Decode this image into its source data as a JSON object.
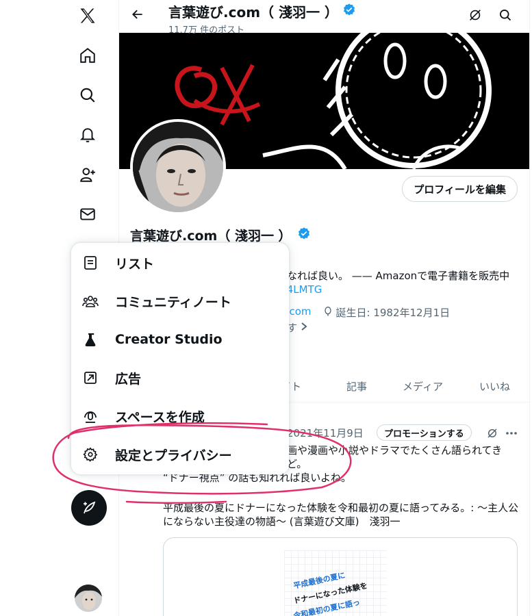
{
  "nav": {
    "items": [
      {
        "name": "x-logo-icon"
      },
      {
        "name": "home-icon"
      },
      {
        "name": "search-icon"
      },
      {
        "name": "notifications-icon"
      },
      {
        "name": "follow-icon"
      },
      {
        "name": "messages-icon"
      }
    ]
  },
  "header": {
    "title": "言葉遊び.com（ 淺羽一 ）",
    "post_count": "11.7万 件のポスト"
  },
  "profile": {
    "name": "言葉遊び.com（ 淺羽一 ）",
    "edit_label": "プロフィールを編集",
    "bio_line": "になれば良い。 —— Amazonで電子書籍を販売中",
    "bio_link": "IB4LMTG",
    "website": "bi.com",
    "birthday": "誕生日: 1982年12月1日",
    "more": "ます"
  },
  "tabs": [
    "イト",
    "記事",
    "メディア",
    "いいね"
  ],
  "post": {
    "date": "・2021年11月9日",
    "promote_label": "プロモーションする",
    "lines": [
      "映画や漫画や小説やドラマでたくさん語られてき",
      "けど。",
      "“ドナー視点” の話も知れれば良いよね。",
      "平成最後の夏にドナーになった体験を令和最初の夏に語ってみる。: ～主人公",
      "にならない主役達の物語～ (言葉遊び文庫)　淺羽一"
    ],
    "book_lines": [
      "平成最後の夏に",
      "ドナーになった体験を",
      "令和最初の夏に語っ"
    ]
  },
  "menu": {
    "items": [
      {
        "label": "リスト",
        "icon": "list-icon"
      },
      {
        "label": "コミュニティノート",
        "icon": "community-notes-icon"
      },
      {
        "label": "Creator Studio",
        "icon": "creator-studio-icon"
      },
      {
        "label": "広告",
        "icon": "ads-icon"
      },
      {
        "label": "スペースを作成",
        "icon": "spaces-icon"
      },
      {
        "label": "設定とプライバシー",
        "icon": "settings-icon"
      }
    ]
  },
  "colors": {
    "accent": "#1d9bf0",
    "annotation": "#e0306a",
    "text": "#0f1419",
    "muted": "#536471"
  }
}
